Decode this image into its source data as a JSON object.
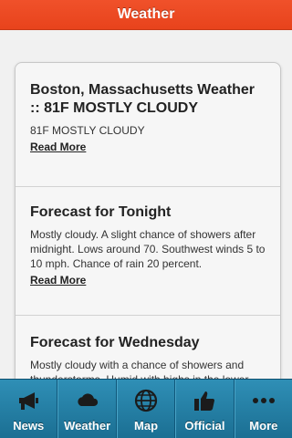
{
  "header": {
    "title": "Weather"
  },
  "items": [
    {
      "title": "Boston, Massachusetts Weather :: 81F MOSTLY CLOUDY",
      "text": "81F MOSTLY CLOUDY",
      "link": "Read More"
    },
    {
      "title": "Forecast for Tonight",
      "text": "Mostly cloudy. A slight chance of showers after midnight. Lows around 70. Southwest winds 5 to 10 mph. Chance of rain 20 percent.",
      "link": "Read More"
    },
    {
      "title": "Forecast for Wednesday",
      "text": "Mostly cloudy with a chance of showers and thunderstorms. Humid with highs in the lower"
    }
  ],
  "tabs": [
    {
      "label": "News",
      "icon": "megaphone-icon"
    },
    {
      "label": "Weather",
      "icon": "cloud-icon"
    },
    {
      "label": "Map",
      "icon": "globe-icon"
    },
    {
      "label": "Official",
      "icon": "thumbs-up-icon"
    },
    {
      "label": "More",
      "icon": "more-dots-icon"
    }
  ]
}
